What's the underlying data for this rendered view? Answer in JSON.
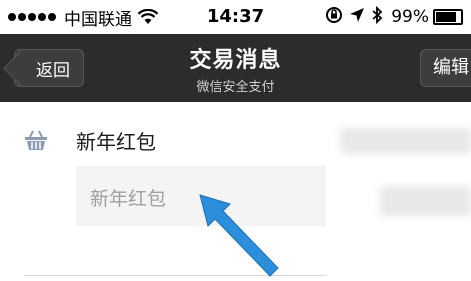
{
  "status_bar": {
    "carrier": "中国联通",
    "time": "14:37",
    "battery_percent": "99%"
  },
  "nav_bar": {
    "back_label": "返回",
    "title": "交易消息",
    "subtitle": "微信安全支付",
    "edit_label": "编辑"
  },
  "message": {
    "title": "新年红包",
    "detail": "新年红包"
  },
  "colors": {
    "nav_background": "#2c2c2c",
    "arrow": "#2b8fdb"
  },
  "icons": {
    "signal": "signal-dots-icon",
    "wifi": "wifi-icon",
    "lock_rotation": "rotation-lock-icon",
    "location": "location-arrow-icon",
    "bluetooth": "bluetooth-icon",
    "battery": "battery-icon",
    "basket": "basket-icon",
    "pointer": "arrow-pointer-icon"
  }
}
